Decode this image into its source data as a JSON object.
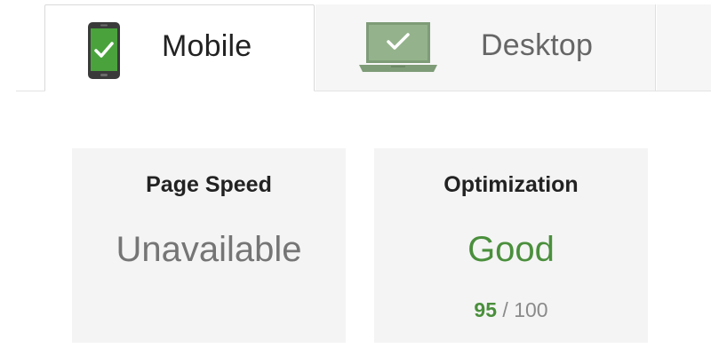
{
  "tabs": [
    {
      "label": "Mobile",
      "icon": "phone-check-icon",
      "active": true
    },
    {
      "label": "Desktop",
      "icon": "laptop-check-icon",
      "active": false
    }
  ],
  "cards": {
    "page_speed": {
      "title": "Page Speed",
      "value": "Unavailable"
    },
    "optimization": {
      "title": "Optimization",
      "value": "Good",
      "score": "95",
      "score_separator": " / ",
      "score_max": "100"
    }
  },
  "colors": {
    "good_green": "#4a8f3c",
    "phone_green": "#49a23c",
    "laptop_green": "#8fae87",
    "card_bg": "#f4f4f4"
  }
}
